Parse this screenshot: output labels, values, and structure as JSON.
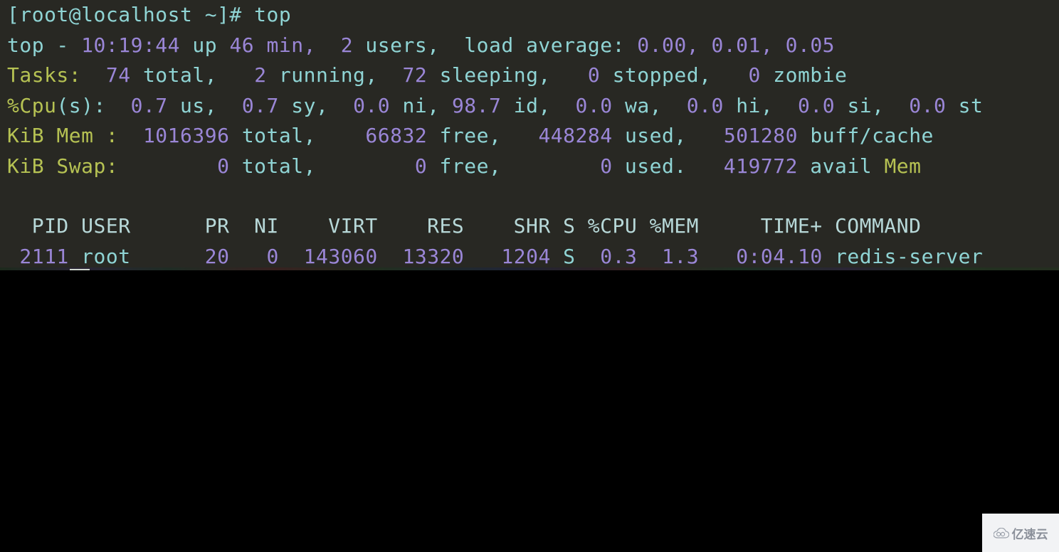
{
  "terminal": {
    "background_color": "#282823",
    "colors": {
      "cyan": "#8fd4d4",
      "purple": "#9a86d6",
      "yellow_green": "#b6c253",
      "white": "#e8e8e8",
      "header": "#b7d8d8"
    },
    "prompt_line": {
      "prompt": "[root@localhost ~]# ",
      "command": "top"
    },
    "summary": {
      "uptime_line": {
        "program": "top -",
        "time": "10:19:44",
        "up_label": "up",
        "uptime": "46 min,",
        "users_count": "2",
        "users_label": "users,",
        "load_label": "load average:",
        "load_1": "0.00,",
        "load_5": "0.01,",
        "load_15": "0.05"
      },
      "tasks_line": {
        "label": "Tasks:",
        "total_value": "74",
        "total_label": "total,",
        "running_value": "2",
        "running_label": "running,",
        "sleeping_value": "72",
        "sleeping_label": "sleeping,",
        "stopped_value": "0",
        "stopped_label": "stopped,",
        "zombie_value": "0",
        "zombie_label": "zombie"
      },
      "cpu_line": {
        "label": "%Cpu",
        "label_suffix": "(s):",
        "us_value": "0.7",
        "us_label": "us,",
        "sy_value": "0.7",
        "sy_label": "sy,",
        "ni_value": "0.0",
        "ni_label": "ni,",
        "id_value": "98.7",
        "id_label": "id,",
        "wa_value": "0.0",
        "wa_label": "wa,",
        "hi_value": "0.0",
        "hi_label": "hi,",
        "si_value": "0.0",
        "si_label": "si,",
        "st_value": "0.0",
        "st_label": "st"
      },
      "mem_line": {
        "label": "KiB Mem :",
        "total_value": "1016396",
        "total_label": "total,",
        "free_value": "66832",
        "free_label": "free,",
        "used_value": "448284",
        "used_label": "used,",
        "buff_value": "501280",
        "buff_label": "buff/cache"
      },
      "swap_line": {
        "label": "KiB Swap:",
        "total_value": "0",
        "total_label": "total,",
        "free_value": "0",
        "free_label": "free,",
        "used_value": "0",
        "used_label": "used.",
        "avail_value": "419772",
        "avail_label": "avail",
        "avail_suffix": "Mem"
      }
    },
    "process_table": {
      "headers": [
        "PID",
        "USER",
        "PR",
        "NI",
        "VIRT",
        "RES",
        "SHR",
        "S",
        "%CPU",
        "%MEM",
        "TIME+",
        "COMMAND"
      ],
      "header_line": "  PID USER      PR  NI    VIRT    RES    SHR S %CPU %MEM     TIME+ COMMAND",
      "rows": [
        {
          "pid": "2111",
          "user": "root",
          "pr": "20",
          "ni": "0",
          "virt": "143060",
          "res": "13320",
          "shr": "1204",
          "s": "S",
          "cpu": "0.3",
          "mem": "1.3",
          "time": "0:04.10",
          "command": "redis-server"
        }
      ]
    }
  },
  "watermark": {
    "icon": "cloud-icon",
    "text": "亿速云"
  }
}
